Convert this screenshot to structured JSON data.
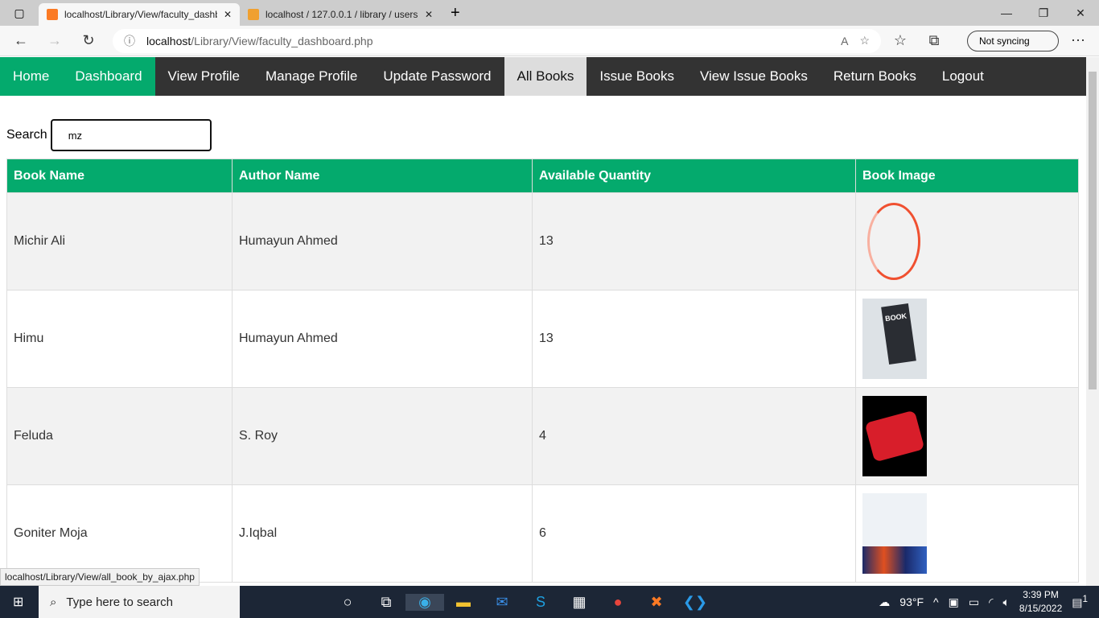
{
  "browser": {
    "tabs": [
      {
        "title": "localhost/Library/View/faculty_dashboard.php",
        "active": true
      },
      {
        "title": "localhost / 127.0.0.1 / library / users",
        "active": false
      }
    ],
    "url_host": "localhost",
    "url_path": "/Library/View/faculty_dashboard.php",
    "sync_label": "Not syncing",
    "status_url": "localhost/Library/View/all_book_by_ajax.php"
  },
  "nav": {
    "items": [
      {
        "label": "Home"
      },
      {
        "label": "Dashboard"
      },
      {
        "label": "View Profile"
      },
      {
        "label": "Manage Profile"
      },
      {
        "label": "Update Password"
      },
      {
        "label": "All Books"
      },
      {
        "label": "Issue Books"
      },
      {
        "label": "View Issue Books"
      },
      {
        "label": "Return Books"
      },
      {
        "label": "Logout"
      }
    ]
  },
  "search": {
    "label": "Search",
    "value": "mz"
  },
  "table": {
    "headers": [
      "Book Name",
      "Author Name",
      "Available Quantity",
      "Book Image"
    ],
    "rows": [
      {
        "name": "Michir Ali",
        "author": "Humayun Ahmed",
        "qty": "13"
      },
      {
        "name": "Himu",
        "author": "Humayun Ahmed",
        "qty": "13"
      },
      {
        "name": "Feluda",
        "author": "S. Roy",
        "qty": "4"
      },
      {
        "name": "Goniter Moja",
        "author": "J.Iqbal",
        "qty": "6"
      }
    ]
  },
  "taskbar": {
    "search_placeholder": "Type here to search",
    "weather": "93°F",
    "time": "3:39 PM",
    "date": "8/15/2022",
    "notifications": "1"
  },
  "colors": {
    "accent": "#04AA6D",
    "nav_bg": "#333333"
  }
}
